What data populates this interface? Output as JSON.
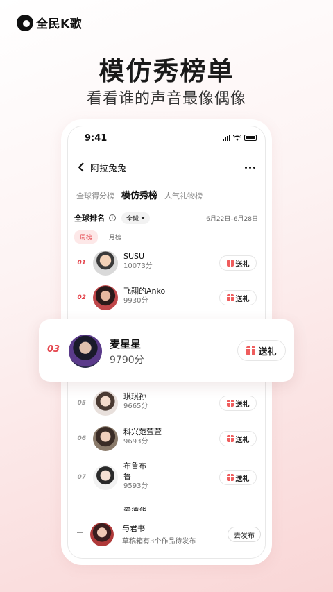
{
  "brand": {
    "name": "全民K歌"
  },
  "headline": "模仿秀榜单",
  "subhead": "看看谁的声音最像偶像",
  "status": {
    "time": "9:41"
  },
  "nav": {
    "title": "阿拉兔兔"
  },
  "tabs": [
    {
      "label": "全球得分榜",
      "active": false
    },
    {
      "label": "模仿秀榜",
      "active": true
    },
    {
      "label": "人气礼物榜",
      "active": false
    }
  ],
  "rank_header": {
    "title": "全球排名",
    "scope": "全球",
    "date_range": "6月22日–6月28日"
  },
  "period_tabs": [
    {
      "label": "周榜",
      "active": true
    },
    {
      "label": "月榜",
      "active": false
    }
  ],
  "gift_label": "送礼",
  "rows": [
    {
      "rank": "01",
      "name": "SUSU",
      "score": "10073分"
    },
    {
      "rank": "02",
      "name": "飞翔的Anko",
      "score": "9930分"
    },
    {
      "rank": "05",
      "name": "琪琪孙",
      "score": "9665分"
    },
    {
      "rank": "06",
      "name": "科兴范萱萱",
      "score": "9693分"
    },
    {
      "rank": "07",
      "name_line1": "布鲁布",
      "name_line2": "鲁",
      "score": "9593分"
    }
  ],
  "peek_name": "爱德华",
  "highlight": {
    "rank": "03",
    "name": "麦星星",
    "score": "9790分",
    "gift_label": "送礼"
  },
  "draft": {
    "name": "与君书",
    "subtitle": "草稿箱有3个作品待发布",
    "button": "去发布"
  },
  "colors": {
    "accent": "#e4454d",
    "gift": "#ef5d5d"
  }
}
